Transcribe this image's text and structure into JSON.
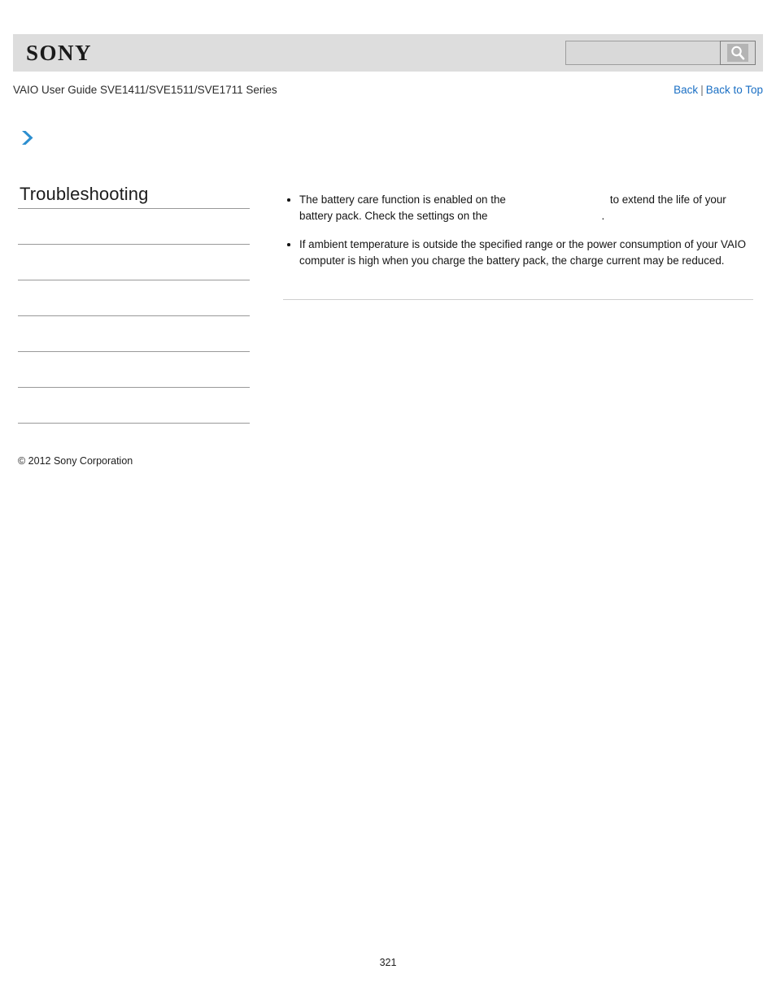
{
  "header": {
    "logo": "SONY",
    "search": {
      "value": "",
      "placeholder": "",
      "button_icon": "search-icon"
    }
  },
  "subheader": {
    "guide_title": "VAIO User Guide SVE1411/SVE1511/SVE1711 Series",
    "nav": {
      "back": "Back",
      "separator": "|",
      "back_to_top": "Back to Top"
    }
  },
  "sidebar": {
    "arrow_icon": "double-chevron-right-icon",
    "title": "Troubleshooting",
    "items": [
      {
        "label": ""
      },
      {
        "label": ""
      },
      {
        "label": ""
      },
      {
        "label": ""
      },
      {
        "label": ""
      },
      {
        "label": ""
      }
    ]
  },
  "main": {
    "bullets": [
      {
        "segments": [
          {
            "type": "text",
            "value": "The battery care function is enabled on the "
          },
          {
            "type": "link",
            "value": ""
          },
          {
            "type": "text",
            "value": " to extend the life of your battery pack. Check the settings on the "
          },
          {
            "type": "link",
            "value": ""
          },
          {
            "type": "text",
            "value": "."
          }
        ],
        "text_part_1": "The battery care function is enabled on the",
        "text_part_2": "to extend the life of your battery pack. Check the settings on the",
        "text_part_3": "."
      },
      {
        "text": "If ambient temperature is outside the specified range or the power consumption of your VAIO computer is high when you charge the battery pack, the charge current may be reduced."
      }
    ]
  },
  "footer": {
    "copyright": "© 2012 Sony Corporation",
    "page_number": "321"
  },
  "colors": {
    "header_bg": "#dddddd",
    "link_blue": "#1a6fc4",
    "arrow_blue": "#2d8fd0",
    "divider": "#999999",
    "content_rule": "#cfcfcf"
  }
}
